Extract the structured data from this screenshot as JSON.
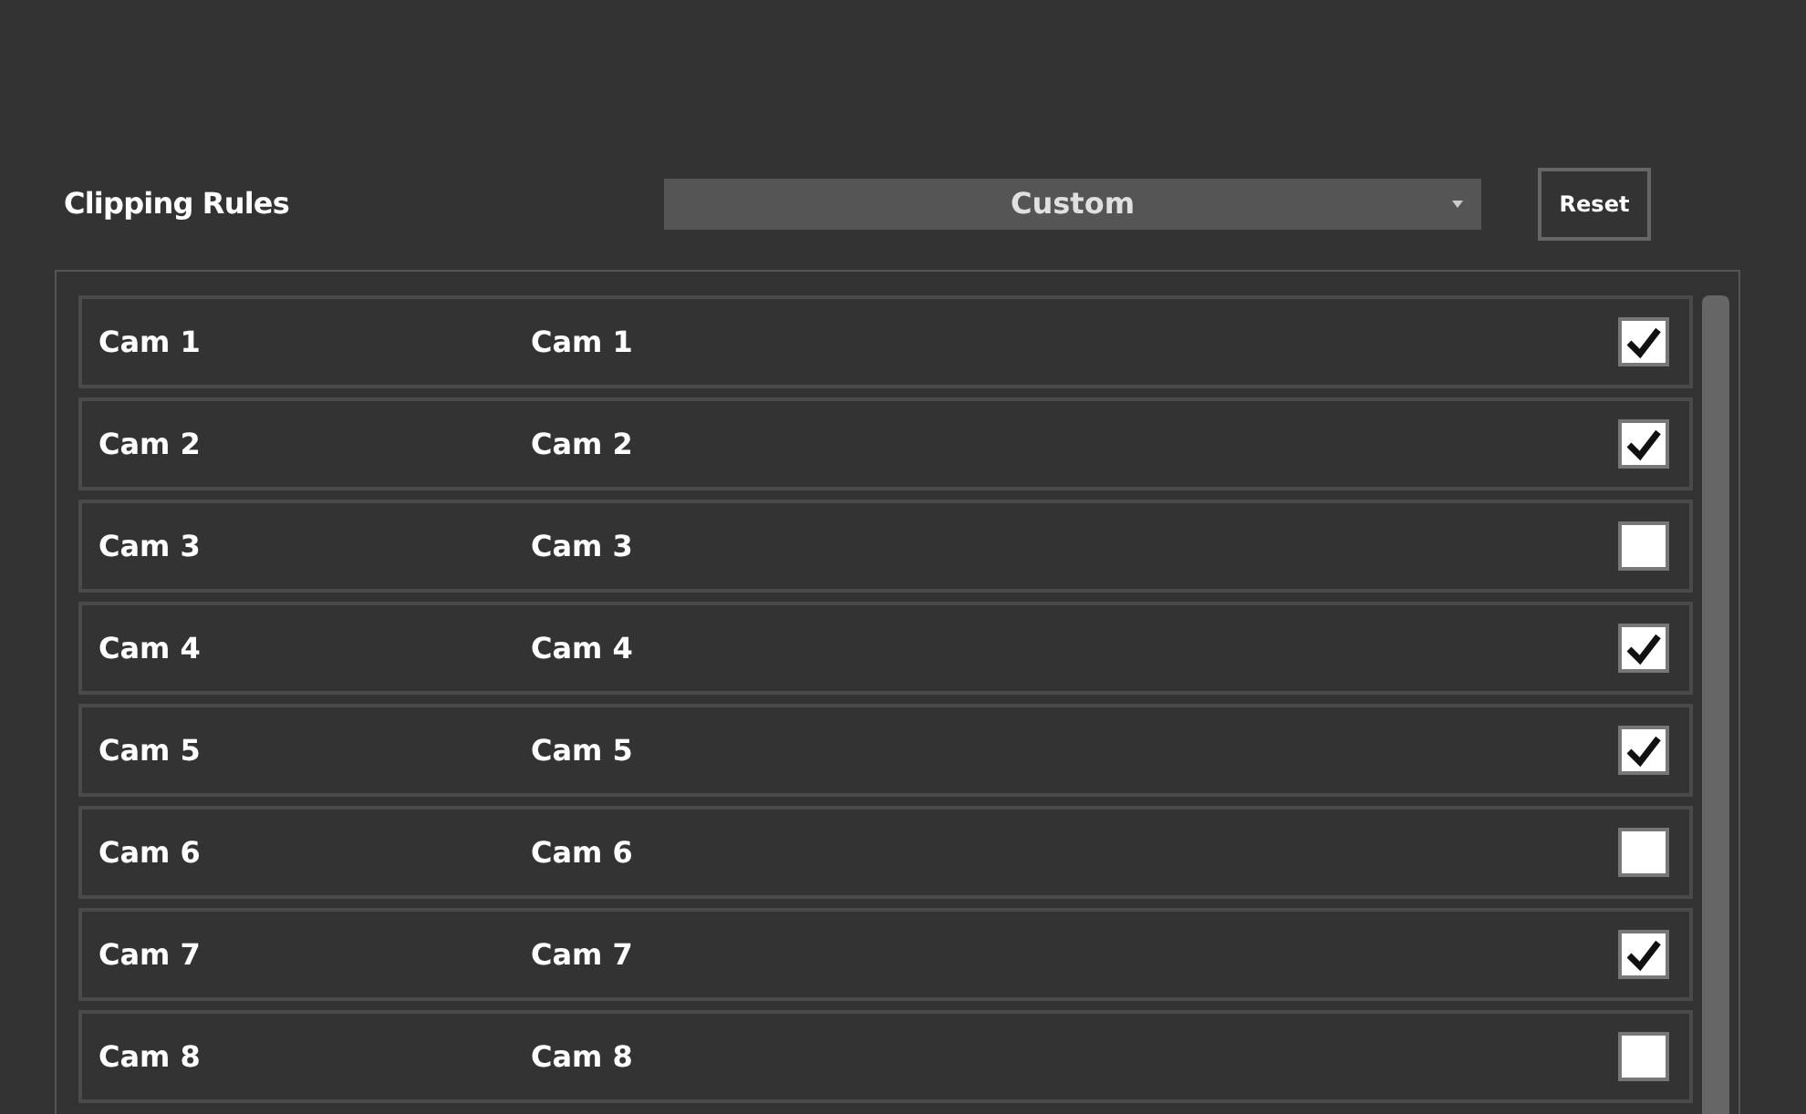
{
  "header": {
    "title": "Clipping Rules",
    "dropdown": {
      "value": "Custom"
    },
    "reset_button": "Reset"
  },
  "rows": [
    {
      "column_1": "Cam 1",
      "column_2": "Cam 1",
      "checked": true
    },
    {
      "column_1": "Cam 2",
      "column_2": "Cam 2",
      "checked": true
    },
    {
      "column_1": "Cam 3",
      "column_2": "Cam 3",
      "checked": false
    },
    {
      "column_1": "Cam 4",
      "column_2": "Cam 4",
      "checked": true
    },
    {
      "column_1": "Cam 5",
      "column_2": "Cam 5",
      "checked": true
    },
    {
      "column_1": "Cam 6",
      "column_2": "Cam 6",
      "checked": false
    },
    {
      "column_1": "Cam 7",
      "column_2": "Cam 7",
      "checked": true
    },
    {
      "column_1": "Cam 8",
      "column_2": "Cam 8",
      "checked": false
    }
  ]
}
